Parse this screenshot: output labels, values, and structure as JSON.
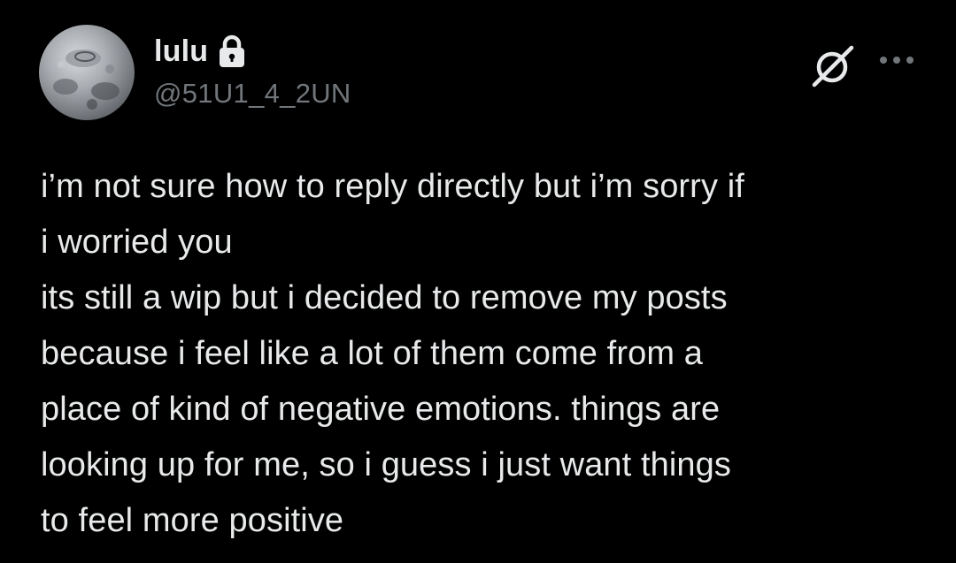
{
  "theme": {
    "background": "#000000",
    "text_primary": "#e7e9ea",
    "text_secondary": "#71767b"
  },
  "author": {
    "display_name": "lulu",
    "handle": "@51U1_4_2UN",
    "protected_icon": "lock-icon",
    "avatar_icon": "avatar"
  },
  "actions": {
    "grok_icon": "grok-icon",
    "more_icon": "more-icon"
  },
  "tweet": {
    "text": "i’m not sure how to reply directly but i’m sorry if\ni worried you\nits still a wip but i decided to remove my posts\nbecause i feel like a lot of them come from a\nplace of kind of negative emotions. things are\nlooking up for me, so i guess i just want things\nto feel more positive"
  }
}
